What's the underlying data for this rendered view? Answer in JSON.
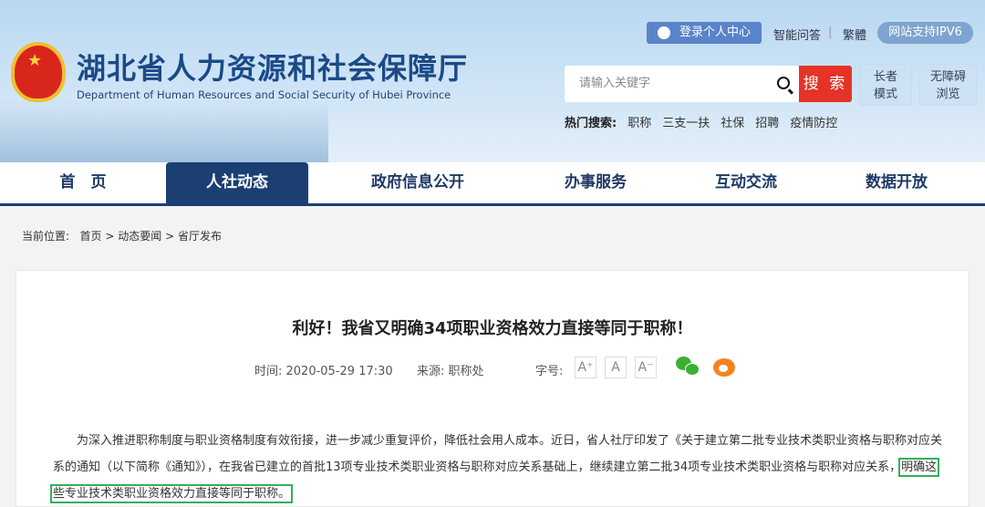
{
  "header": {
    "title_cn": "湖北省人力资源和社会保障厅",
    "title_en": "Department of Human Resources and Social Security of Hubei Province",
    "emblem_star": "★"
  },
  "topbar": {
    "login": "登录个人中心",
    "qa": "智能问答",
    "sep": "|",
    "traditional": "繁體",
    "ipv6": "网站支持IPV6"
  },
  "search": {
    "placeholder": "请输入关键字",
    "button": "搜 索"
  },
  "modes": {
    "elder_1": "长者",
    "elder_2": "模式",
    "access_1": "无障碍",
    "access_2": "浏览"
  },
  "hot": {
    "label": "热门搜索:",
    "items": [
      "职称",
      "三支一扶",
      "社保",
      "招聘",
      "疫情防控"
    ]
  },
  "nav": [
    "首　页",
    "人社动态",
    "政府信息公开",
    "办事服务",
    "互动交流",
    "数据开放"
  ],
  "breadcrumb": {
    "label": "当前位置:",
    "items": [
      "首页",
      ">",
      "动态要闻",
      ">",
      "省厅发布"
    ]
  },
  "article": {
    "title": "利好！我省又明确34项职业资格效力直接等同于职称！",
    "time": "时间: 2020-05-29 17:30",
    "source": "来源:  职称处",
    "fontsize_label": "字号:",
    "fs": [
      "A⁺",
      "A",
      "A⁻"
    ],
    "para_1": "为深入推进职称制度与职业资格制度有效衔接，进一步减少重复评价，降低社会用人成本。近日，省人社厅印发了《关于建立第二批专业技术类职业资格与职称对应关系的通知（以下简称《通知》），在我省已建立的首批13项专业技术类职业资格与职称对应关系基础上，继续建立第二批34项专业技术类职业资格与职称对应关系，",
    "para_hl": "明确这些专业技术类职业资格效力直接等同于职称。"
  }
}
